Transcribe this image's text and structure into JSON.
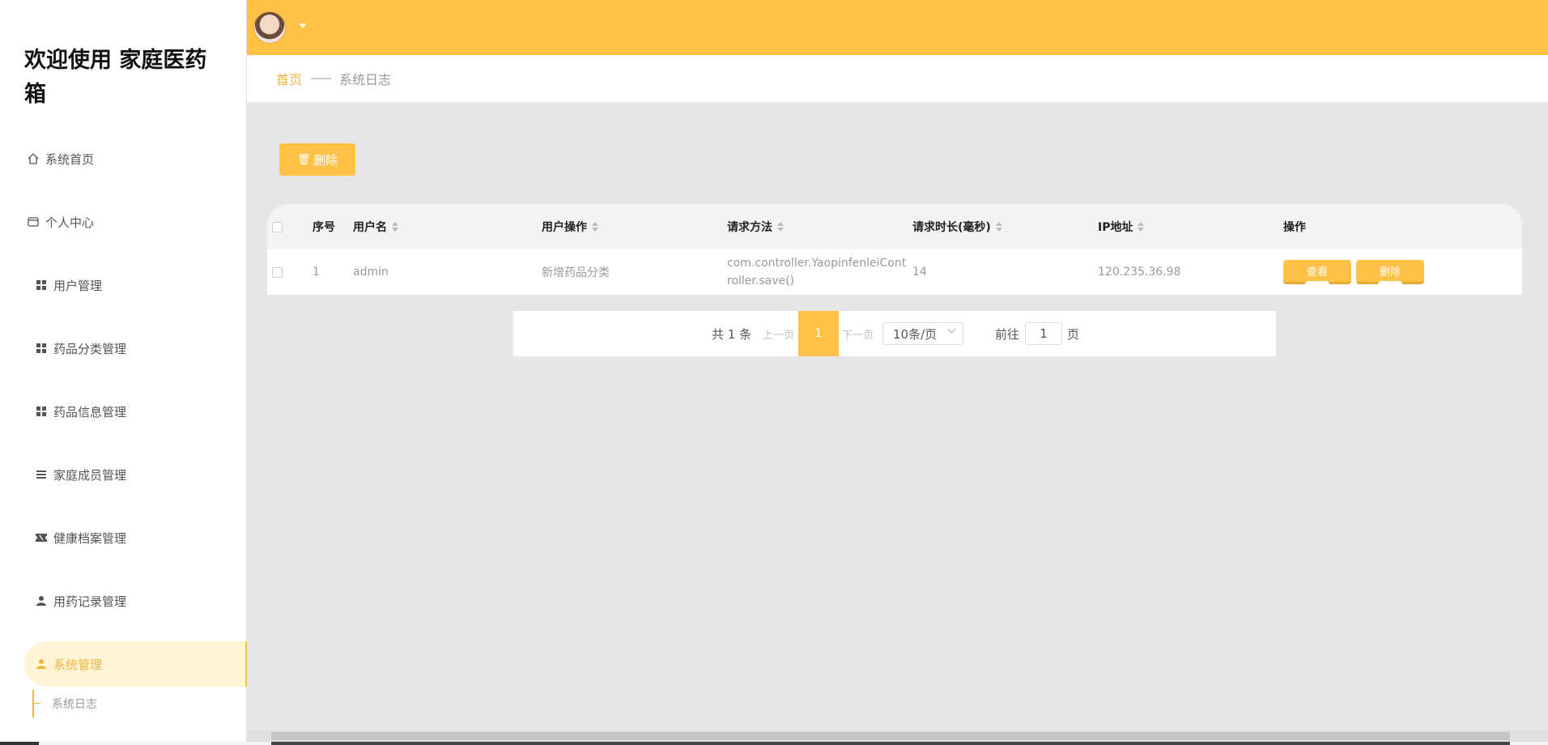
{
  "sidebar": {
    "welcome": "欢迎使用 家庭医药箱",
    "items": [
      {
        "label": "系统首页",
        "icon": "home-icon"
      },
      {
        "label": "个人中心",
        "icon": "wallet-icon"
      },
      {
        "label": "用户管理",
        "icon": "grid-icon"
      },
      {
        "label": "药品分类管理",
        "icon": "grid-icon"
      },
      {
        "label": "药品信息管理",
        "icon": "grid-icon"
      },
      {
        "label": "家庭成员管理",
        "icon": "list-icon"
      },
      {
        "label": "健康档案管理",
        "icon": "ticket-icon"
      },
      {
        "label": "用药记录管理",
        "icon": "user-icon"
      },
      {
        "label": "系统管理",
        "icon": "user-icon",
        "active": true
      }
    ],
    "submenu": "系统日志"
  },
  "breadcrumb": {
    "home": "首页",
    "separator": "——",
    "current": "系统日志"
  },
  "toolbar": {
    "delete_label": "删除"
  },
  "table": {
    "headers": [
      "序号",
      "用户名",
      "用户操作",
      "请求方法",
      "请求时长(毫秒)",
      "IP地址",
      "操作"
    ],
    "rows": [
      {
        "index": "1",
        "username": "admin",
        "operation": "新增药品分类",
        "method": "com.controller.YaopinfenleiController.save()",
        "duration": "14",
        "ip": "120.235.36.98"
      }
    ],
    "view_label": "查看",
    "delete_label": "删除"
  },
  "pagination": {
    "total": "共 1 条",
    "prev": "上一页",
    "current": "1",
    "next": "下一页",
    "page_size": "10条/页",
    "goto_label": "前往",
    "goto_value": "1",
    "page_unit": "页"
  },
  "colors": {
    "accent": "#ffc247",
    "active_bg": "#fff5d6",
    "active_text": "#f2b33d"
  }
}
